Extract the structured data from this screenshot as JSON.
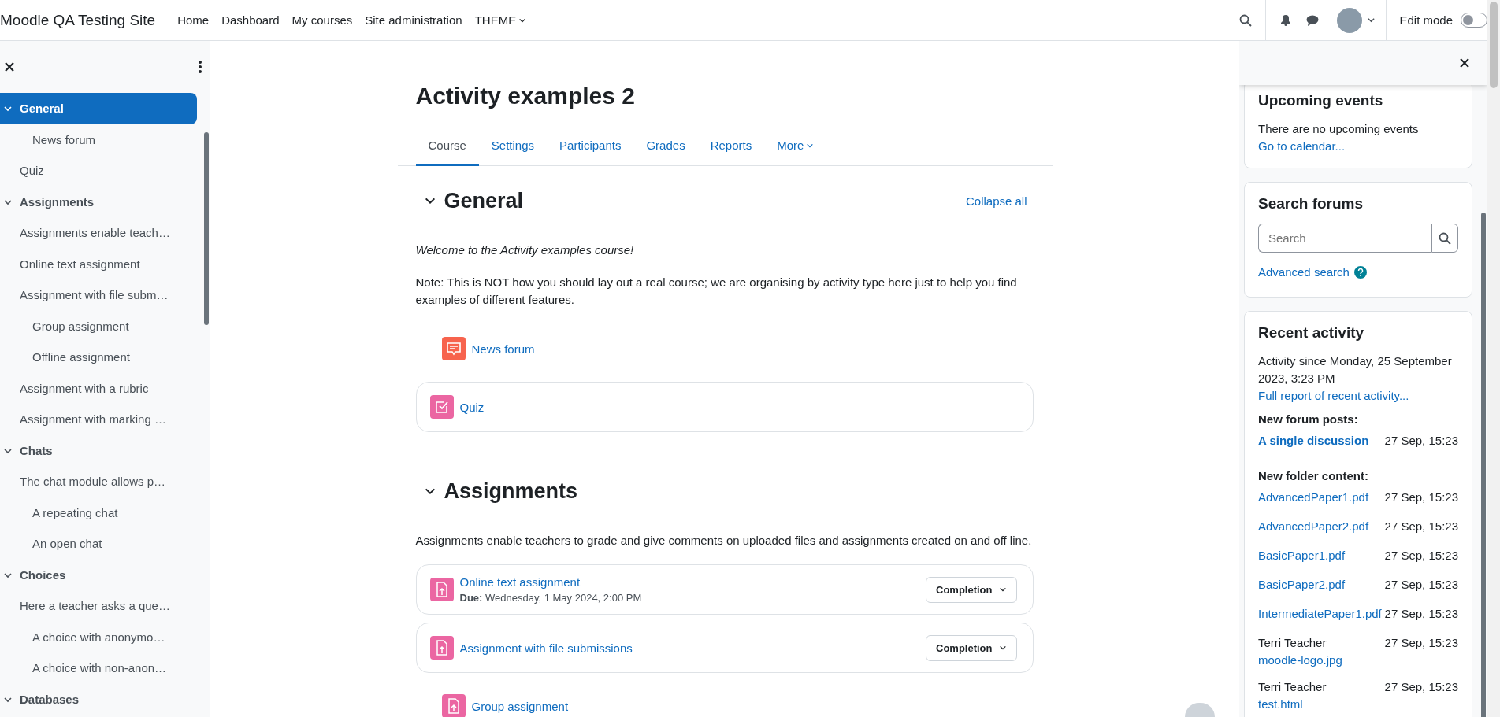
{
  "navbar": {
    "site_name": "Moodle QA Testing Site",
    "links": [
      {
        "label": "Home",
        "dropdown": false
      },
      {
        "label": "Dashboard",
        "dropdown": false
      },
      {
        "label": "My courses",
        "dropdown": false
      },
      {
        "label": "Site administration",
        "dropdown": false
      },
      {
        "label": "THEME",
        "dropdown": true
      }
    ],
    "edit_mode": {
      "label": "Edit mode",
      "on": false
    }
  },
  "course_index": {
    "sections": [
      {
        "title": "General",
        "selected": true,
        "expanded": true,
        "items": [
          {
            "label": "News forum",
            "indented": true
          },
          {
            "label": "Quiz",
            "indented": false
          }
        ]
      },
      {
        "title": "Assignments",
        "selected": false,
        "expanded": true,
        "items": [
          {
            "label": "Assignments enable teach…",
            "indented": false
          },
          {
            "label": "Online text assignment",
            "indented": false
          },
          {
            "label": "Assignment with file subm…",
            "indented": false
          },
          {
            "label": "Group assignment",
            "indented": true
          },
          {
            "label": "Offline assignment",
            "indented": true
          },
          {
            "label": "Assignment with a rubric",
            "indented": false
          },
          {
            "label": "Assignment with marking …",
            "indented": false
          }
        ]
      },
      {
        "title": "Chats",
        "selected": false,
        "expanded": true,
        "items": [
          {
            "label": "The chat module allows p…",
            "indented": false
          },
          {
            "label": "A repeating chat",
            "indented": true
          },
          {
            "label": "An open chat",
            "indented": true
          }
        ]
      },
      {
        "title": "Choices",
        "selected": false,
        "expanded": true,
        "items": [
          {
            "label": "Here a teacher asks a que…",
            "indented": false
          },
          {
            "label": "A choice with anonymo…",
            "indented": true
          },
          {
            "label": "A choice with non-anon…",
            "indented": true
          }
        ]
      },
      {
        "title": "Databases",
        "selected": false,
        "expanded": true
      }
    ]
  },
  "page": {
    "title": "Activity examples 2",
    "tabs": [
      {
        "label": "Course",
        "selected": true,
        "dropdown": false
      },
      {
        "label": "Settings",
        "selected": false,
        "dropdown": false
      },
      {
        "label": "Participants",
        "selected": false,
        "dropdown": false
      },
      {
        "label": "Grades",
        "selected": false,
        "dropdown": false
      },
      {
        "label": "Reports",
        "selected": false,
        "dropdown": false
      },
      {
        "label": "More",
        "selected": false,
        "dropdown": true
      }
    ],
    "collapse_link": "Collapse all",
    "sections": [
      {
        "title": "General",
        "expanded": true,
        "summary": [
          {
            "kind": "emphasis",
            "text": "Welcome to the Activity examples course!"
          },
          {
            "kind": "plain",
            "text": "Note: This is NOT how you should lay out a real course; we are organising by activity type here just to help you find examples of different features."
          }
        ],
        "activities": [
          {
            "kind": "forum",
            "title": "News forum",
            "card": false,
            "indented": true
          },
          {
            "kind": "quiz",
            "title": "Quiz",
            "card": true,
            "indented": false
          }
        ]
      },
      {
        "title": "Assignments",
        "expanded": true,
        "summary": [
          {
            "kind": "plain",
            "text": "Assignments enable teachers to grade and give comments on uploaded files and assignments created on and off line."
          }
        ],
        "activities": [
          {
            "kind": "assign",
            "title": "Online text assignment",
            "card": true,
            "indented": false,
            "due_label": "Due:",
            "due": "Wednesday, 1 May 2024, 2:00 PM",
            "completion": "Completion"
          },
          {
            "kind": "assign",
            "title": "Assignment with file submissions",
            "card": true,
            "indented": false,
            "completion": "Completion"
          },
          {
            "kind": "assign",
            "title": "Group assignment",
            "card": false,
            "indented": true
          }
        ]
      }
    ]
  },
  "blocks": [
    {
      "kind": "events",
      "title": "Upcoming events",
      "text": "There are no upcoming events",
      "link": "Go to calendar..."
    },
    {
      "kind": "search",
      "title": "Search forums",
      "placeholder": "Search",
      "link": "Advanced search"
    },
    {
      "kind": "recent",
      "title": "Recent activity",
      "since": "Activity since Monday, 25 September 2023, 3:23 PM",
      "report_link": "Full report of recent activity...",
      "groups": [
        {
          "heading": "New forum posts:",
          "entries": [
            {
              "kind": "post",
              "link": "A single discussion",
              "time": "27 Sep, 15:23"
            }
          ]
        },
        {
          "heading": "New folder content:",
          "entries": [
            {
              "kind": "file",
              "link": "AdvancedPaper1.pdf",
              "time": "27 Sep, 15:23"
            },
            {
              "kind": "file",
              "link": "AdvancedPaper2.pdf",
              "time": "27 Sep, 15:23"
            },
            {
              "kind": "file",
              "link": "BasicPaper1.pdf",
              "time": "27 Sep, 15:23"
            },
            {
              "kind": "file",
              "link": "BasicPaper2.pdf",
              "time": "27 Sep, 15:23"
            },
            {
              "kind": "file",
              "link": "IntermediatePaper1.pdf",
              "time": "27 Sep, 15:23"
            },
            {
              "kind": "file",
              "user": "Terri Teacher",
              "link": "moodle-logo.jpg",
              "time": "27 Sep, 15:23"
            },
            {
              "kind": "file",
              "user": "Terri Teacher",
              "link": "test.html",
              "time": "27 Sep, 15:23"
            }
          ]
        }
      ]
    }
  ]
}
